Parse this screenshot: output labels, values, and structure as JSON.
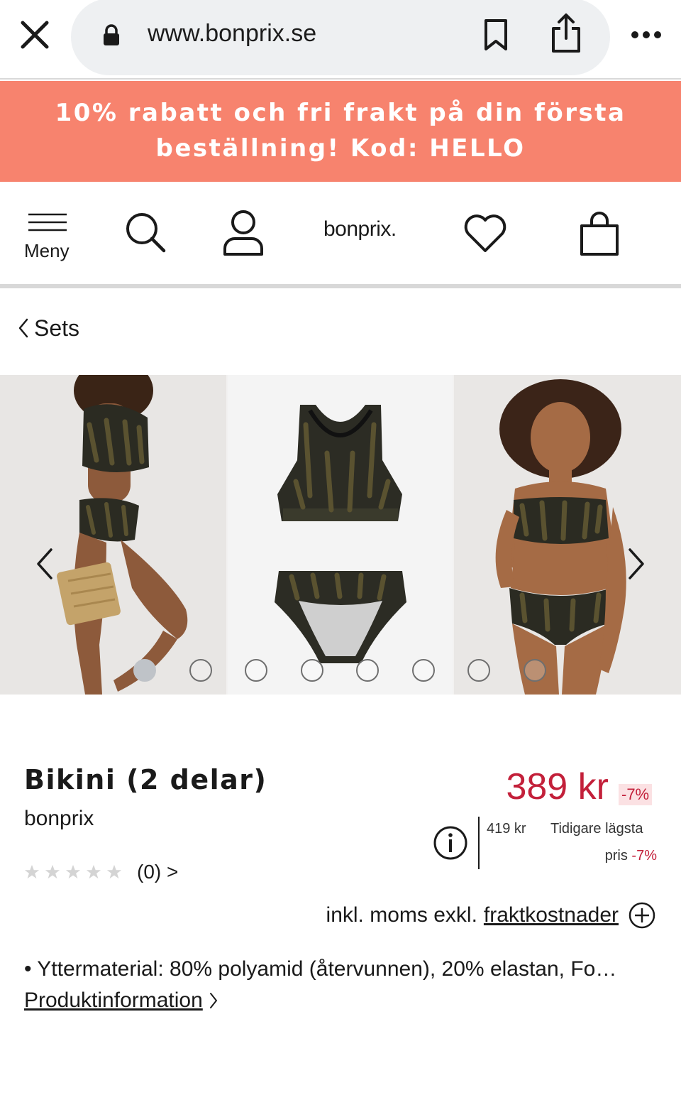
{
  "browser": {
    "url": "www.bonprix.se"
  },
  "promo": {
    "line1": "10% rabatt och fri frakt på din första",
    "line2": "beställning! Kod: HELLO",
    "bg_color": "#f7836e"
  },
  "nav": {
    "menu_label": "Meny",
    "logo_text": "bonprix.",
    "icons": [
      "search-icon",
      "user-icon",
      "heart-icon",
      "bag-icon"
    ]
  },
  "breadcrumb": {
    "label": "Sets"
  },
  "gallery": {
    "image_count": 8,
    "active_index": 0
  },
  "product": {
    "title": "Bikini (2 delar)",
    "brand": "bonprix",
    "rating_stars": 0,
    "rating_count": "(0) >",
    "price": "389 kr",
    "discount": "-7%",
    "previous_price": "419 kr",
    "lowest_label_1": "Tidigare lägsta",
    "lowest_label_2": "pris",
    "lowest_discount": "-7%",
    "tax_text": "inkl. moms exkl.",
    "shipping_link": "fraktkostnader",
    "material": "• Yttermaterial: 80% polyamid (återvunnen), 20% elastan, Fo…",
    "product_info_link": "Produktinformation",
    "price_color": "#c3203a"
  }
}
